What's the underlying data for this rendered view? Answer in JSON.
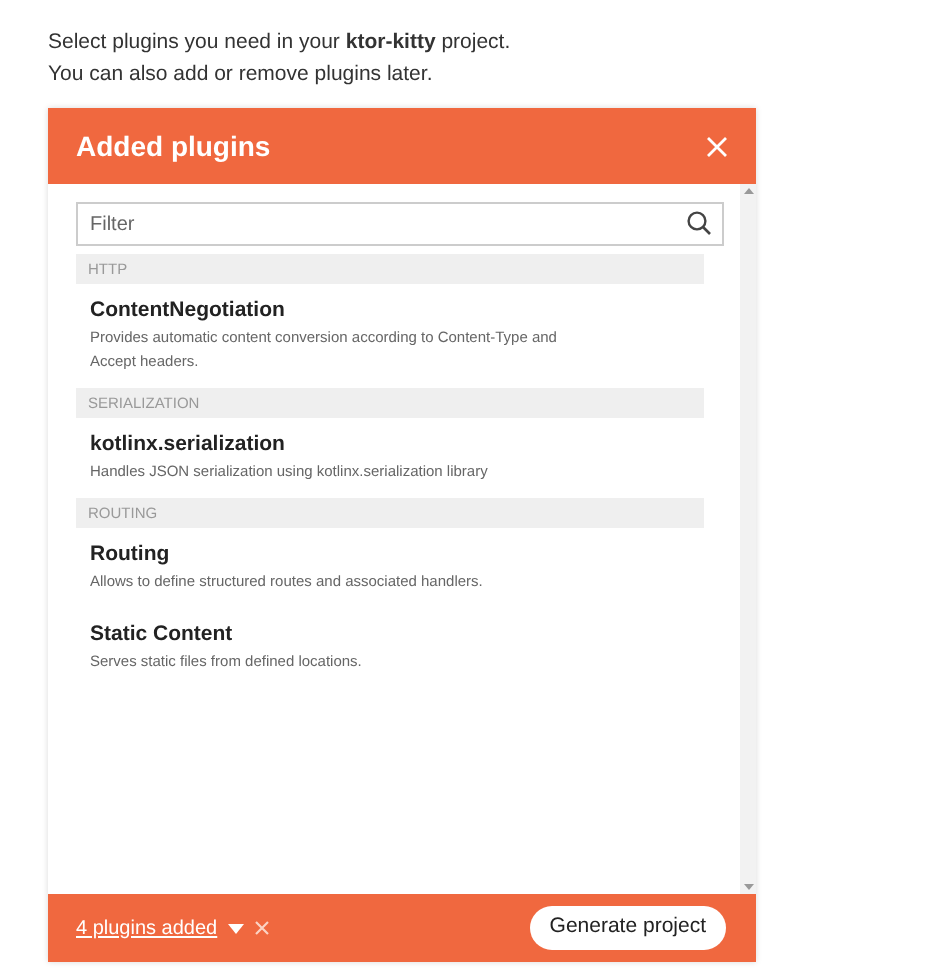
{
  "intro": [
    "Select plugins you need in your **ktor-kitty** project.",
    "You can also add or remove plugins later."
  ],
  "panel": {
    "title": "Added plugins",
    "filter": {
      "placeholder": "Filter"
    },
    "groups": [
      {
        "name": "HTTP",
        "plugins": [
          {
            "name": "ContentNegotiation",
            "description": "Provides automatic content conversion according to Content-Type and Accept headers."
          }
        ]
      },
      {
        "name": "SERIALIZATION",
        "plugins": [
          {
            "name": "kotlinx.serialization",
            "description": "Handles JSON serialization using kotlinx.serialization library"
          }
        ]
      },
      {
        "name": "ROUTING",
        "plugins": [
          {
            "name": "Routing",
            "description": "Allows to define structured routes and associated handlers."
          },
          {
            "name": "Static Content",
            "description": "Serves static files from defined locations."
          }
        ]
      }
    ],
    "footer": {
      "count_link": "4 plugins added",
      "button": "Generate project"
    }
  }
}
